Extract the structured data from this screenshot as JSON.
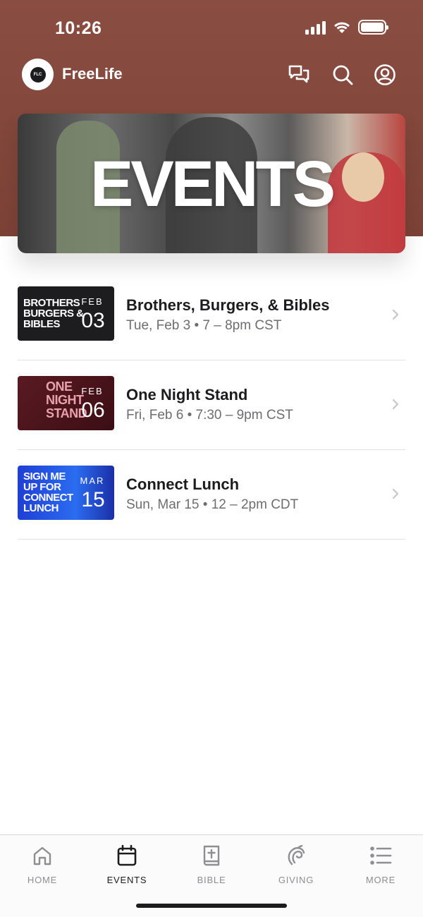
{
  "status_bar": {
    "time": "10:26"
  },
  "app": {
    "logo_text": "FLC",
    "title": "FreeLife"
  },
  "hero": {
    "text": "EVENTS"
  },
  "events": [
    {
      "title": "Brothers, Burgers, & Bibles",
      "when": "Tue, Feb 3 • 7 – 8pm CST",
      "thumb_text": "BROTHERS BURGERS & BIBLES",
      "month": "FEB",
      "day": "03",
      "thumb_color": "#1d1d1f"
    },
    {
      "title": "One Night Stand",
      "when": "Fri, Feb 6 • 7:30 – 9pm CST",
      "thumb_text": "ONE NIGHT STAND",
      "month": "FEB",
      "day": "06",
      "thumb_color": "#5a1a22"
    },
    {
      "title": "Connect Lunch",
      "when": "Sun, Mar 15 • 12 – 2pm CDT",
      "thumb_text": "SIGN ME UP FOR CONNECT LUNCH",
      "month": "MAR",
      "day": "15",
      "thumb_color": "#1f3fd6"
    }
  ],
  "tabs": [
    {
      "label": "HOME",
      "icon": "home-icon"
    },
    {
      "label": "EVENTS",
      "icon": "calendar-icon",
      "active": true
    },
    {
      "label": "BIBLE",
      "icon": "bible-icon"
    },
    {
      "label": "GIVING",
      "icon": "giving-icon"
    },
    {
      "label": "MORE",
      "icon": "list-icon"
    }
  ],
  "colors": {
    "header_bg": "#8a4d41",
    "active_tab": "#1c1c1e",
    "inactive_tab": "#8e8e93"
  }
}
